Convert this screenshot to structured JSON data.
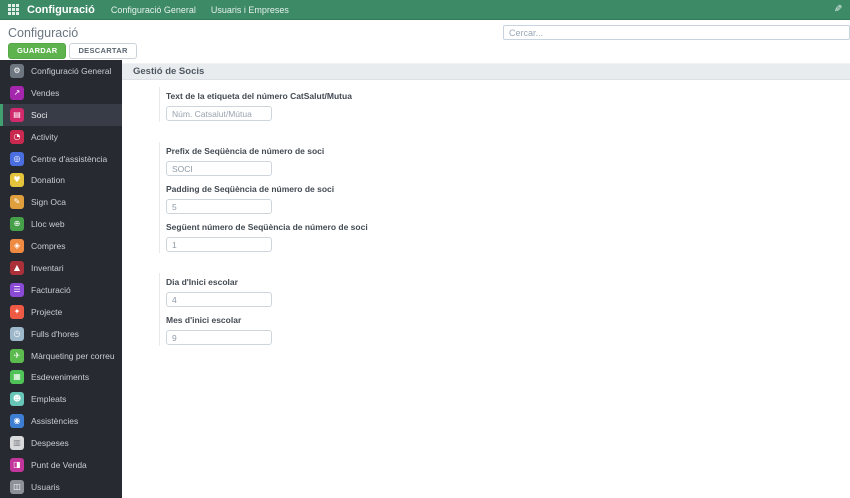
{
  "colors": {
    "topbar_bg": "#3c8a66",
    "save_button": "#5eb34f",
    "sidebar_bg": "#272a31",
    "active_accent": "#41a06f",
    "section_header_bg": "#e9ecef"
  },
  "topbar": {
    "app_name": "Configuració",
    "menus": [
      {
        "label": "Configuració General"
      },
      {
        "label": "Usuaris i Empreses"
      }
    ]
  },
  "control_panel": {
    "breadcrumb": "Configuració",
    "save_label": "GUARDAR",
    "discard_label": "DESCARTAR",
    "search_placeholder": "Cercar..."
  },
  "sidebar": {
    "items": [
      {
        "label": "Configuració General",
        "icon": "gear-icon",
        "glyph": "⚙",
        "color": "#6e7680",
        "active": false
      },
      {
        "label": "Vendes",
        "icon": "sales-chart-icon",
        "glyph": "↗",
        "color": "#a326ad",
        "active": false
      },
      {
        "label": "Soci",
        "icon": "member-card-icon",
        "glyph": "▤",
        "color": "#d02a6c",
        "active": true
      },
      {
        "label": "Activity",
        "icon": "activity-icon",
        "glyph": "◔",
        "color": "#c9284f",
        "active": false
      },
      {
        "label": "Centre d'assistència",
        "icon": "helpdesk-icon",
        "glyph": "◎",
        "color": "#4a6de0",
        "active": false
      },
      {
        "label": "Donation",
        "icon": "donation-icon",
        "glyph": "♥",
        "color": "#e3c43c",
        "active": false
      },
      {
        "label": "Sign Oca",
        "icon": "signature-icon",
        "glyph": "✎",
        "color": "#df9f3d",
        "active": false
      },
      {
        "label": "Lloc web",
        "icon": "globe-icon",
        "glyph": "⊕",
        "color": "#46a049",
        "active": false
      },
      {
        "label": "Compres",
        "icon": "purchase-icon",
        "glyph": "◈",
        "color": "#ee8a41",
        "active": false
      },
      {
        "label": "Inventari",
        "icon": "inventory-icon",
        "glyph": "▲",
        "color": "#aa3039",
        "active": false
      },
      {
        "label": "Facturació",
        "icon": "invoice-icon",
        "glyph": "☰",
        "color": "#8a4ad6",
        "active": false
      },
      {
        "label": "Projecte",
        "icon": "project-icon",
        "glyph": "✦",
        "color": "#ef5a44",
        "active": false
      },
      {
        "label": "Fulls d'hores",
        "icon": "timesheet-icon",
        "glyph": "◷",
        "color": "#9db7cb",
        "active": false
      },
      {
        "label": "Màrqueting per correu",
        "icon": "email-marketing-icon",
        "glyph": "✈",
        "color": "#5cbb4e",
        "active": false
      },
      {
        "label": "Esdeveniments",
        "icon": "events-icon",
        "glyph": "▦",
        "color": "#4fc357",
        "active": false
      },
      {
        "label": "Empleats",
        "icon": "employees-icon",
        "glyph": "☻",
        "color": "#67c6b8",
        "active": false
      },
      {
        "label": "Assistències",
        "icon": "attendance-icon",
        "glyph": "◉",
        "color": "#3d7ed2",
        "active": false
      },
      {
        "label": "Despeses",
        "icon": "expenses-icon",
        "glyph": "▥",
        "color": "#d9dadc",
        "glyph_color": "#7a7f85",
        "active": false
      },
      {
        "label": "Punt de Venda",
        "icon": "pos-icon",
        "glyph": "◨",
        "color": "#c2359b",
        "active": false
      },
      {
        "label": "Usuaris",
        "icon": "users-icon",
        "glyph": "◫",
        "color": "#8d9298",
        "active": false
      }
    ]
  },
  "main": {
    "section_title": "Gestió de Socis",
    "groups": [
      {
        "fields": [
          {
            "label": "Text de la etiqueta del número CatSalut/Mutua",
            "value": "",
            "placeholder": "Núm. Catsalut/Mútua"
          }
        ]
      },
      {
        "fields": [
          {
            "label": "Prefix de Seqüència de número de soci",
            "value": "SOCI"
          },
          {
            "label": "Padding de Seqüència de número de soci",
            "value": "5"
          },
          {
            "label": "Següent número de Seqüència de número de soci",
            "value": "1"
          }
        ]
      },
      {
        "fields": [
          {
            "label": "Dia d'Inici escolar",
            "value": "4"
          },
          {
            "label": "Mes d'inici escolar",
            "value": "9"
          }
        ]
      }
    ]
  }
}
